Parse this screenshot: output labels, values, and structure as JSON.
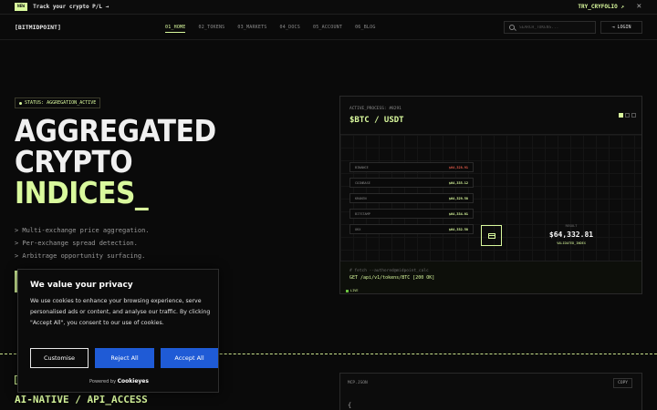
{
  "promo": {
    "badge": "NEW",
    "text": "Track your crypto P/L →",
    "link": "TRY_CRYFOLIO ↗",
    "close": "✕"
  },
  "nav": {
    "logo": "[BITMIDPOINT]",
    "links": [
      "01_HOME",
      "02_TOKENS",
      "03_MARKETS",
      "04_DOCS",
      "05_ACCOUNT",
      "06_BLOG"
    ],
    "active_index": 0,
    "search_placeholder": "SEARCH_TOKENS...",
    "login": "LOGIN"
  },
  "hero": {
    "status": "STATUS: AGGREGATION_ACTIVE",
    "title_line1": "AGGREGATED",
    "title_line2": "CRYPTO",
    "title_line3": "INDICES_",
    "features": [
      "> Multi-exchange price aggregation.",
      "> Per-exchange spread detection.",
      "> Arbitrage opportunity surfacing."
    ]
  },
  "card": {
    "process": "ACTIVE_PROCESS: #8291",
    "pair": "$BTC / USDT",
    "exchanges": [
      {
        "name": "BINANCE",
        "price": "$64,328.91",
        "color": "#e05a4a"
      },
      {
        "name": "COINBASE",
        "price": "$64,335.12",
        "color": "#d9f99d"
      },
      {
        "name": "KRAKEN",
        "price": "$64,329.58",
        "color": "#d9f99d"
      },
      {
        "name": "BITSTAMP",
        "price": "$64,334.01",
        "color": "#d9f99d"
      },
      {
        "name": "OKX",
        "price": "$64,332.58",
        "color": "#d9f99d"
      }
    ],
    "result_label": "RESULT",
    "result_price": "$64,332.81",
    "result_sub": "VALIDATED_INDEX",
    "cmd_comment": "# fetch --authored@midpoint_calc",
    "cmd": "GET /api/v1/tokens/BTC [200 OK]",
    "live": "LIVE"
  },
  "lower": {
    "ai_title": "AI-NATIVE / API_ACCESS",
    "mcp_title": "MCP.JSON",
    "copy": "COPY",
    "mcp_body": "{"
  },
  "cookie": {
    "title": "We value your privacy",
    "body": "We use cookies to enhance your browsing experience, serve personalised ads or content, and analyse our traffic. By clicking \"Accept All\", you consent to our use of cookies.",
    "customise": "Customise",
    "reject": "Reject All",
    "accept": "Accept All",
    "powered": "Powered by",
    "brand": "Cookieyes"
  },
  "colors": {
    "accent": "#d9f99d",
    "background": "#0a0a0a",
    "button_blue": "#1f5bd6"
  }
}
